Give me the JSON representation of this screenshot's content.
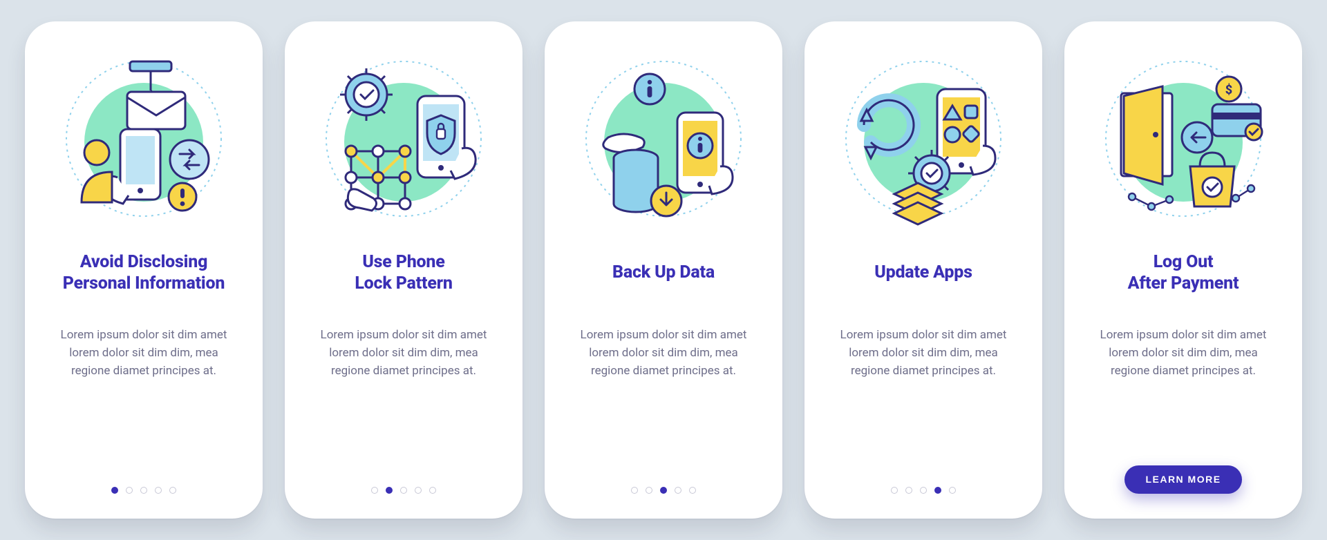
{
  "colors": {
    "page_bg": "#dbe3ea",
    "card_bg": "#ffffff",
    "heading": "#3a2fb5",
    "body": "#6e6e8a",
    "mint": "#8ce7c4",
    "sky": "#8fd1ec",
    "yellow": "#f8d548",
    "outline": "#2f2a7a",
    "dot": "#c8c8d6",
    "dot_active": "#3a2fb5",
    "button_bg": "#3a2fb5",
    "button_text": "#ffffff"
  },
  "screens": [
    {
      "title": "Avoid Disclosing\nPersonal Information",
      "body": "Lorem ipsum dolor sit dim amet lorem dolor sit dim dim, mea regione diamet principes at.",
      "icon": "phishing-privacy-icon",
      "active_dot_index": 0
    },
    {
      "title": "Use Phone\nLock Pattern",
      "body": "Lorem ipsum dolor sit dim amet lorem dolor sit dim dim, mea regione diamet principes at.",
      "icon": "lock-pattern-icon",
      "active_dot_index": 1
    },
    {
      "title": "Back Up Data",
      "body": "Lorem ipsum dolor sit dim amet lorem dolor sit dim dim, mea regione diamet principes at.",
      "icon": "backup-data-icon",
      "active_dot_index": 2
    },
    {
      "title": "Update Apps",
      "body": "Lorem ipsum dolor sit dim amet lorem dolor sit dim dim, mea regione diamet principes at.",
      "icon": "update-apps-icon",
      "active_dot_index": 3
    },
    {
      "title": "Log Out\nAfter Payment",
      "body": "Lorem ipsum dolor sit dim amet lorem dolor sit dim dim, mea regione diamet principes at.",
      "icon": "logout-payment-icon",
      "button_label": "LEARN MORE"
    }
  ],
  "total_dots": 5
}
